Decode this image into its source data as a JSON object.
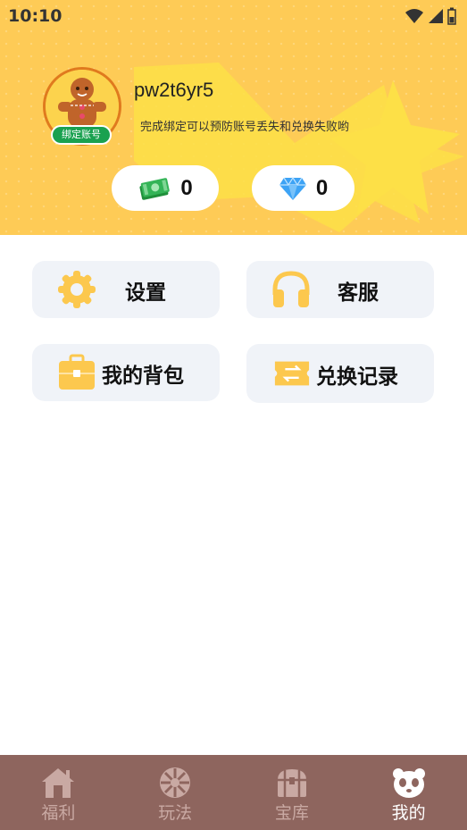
{
  "status": {
    "time": "10:10"
  },
  "profile": {
    "username": "pw2t6yr5",
    "bind_badge": "绑定账号",
    "bind_tip": "完成绑定可以预防账号丢失和兑换失败哟"
  },
  "balances": {
    "cash": "0",
    "gems": "0"
  },
  "menu": {
    "settings": "设置",
    "service": "客服",
    "bag": "我的背包",
    "record": "兑换记录"
  },
  "nav": {
    "items": [
      {
        "label": "福利"
      },
      {
        "label": "玩法"
      },
      {
        "label": "宝库"
      },
      {
        "label": "我的"
      }
    ],
    "active": "我的"
  },
  "colors": {
    "header_bg": "#fecb56",
    "accent": "#fcc84e",
    "nav_bg": "#8e655e",
    "badge_green": "#1aa150"
  }
}
